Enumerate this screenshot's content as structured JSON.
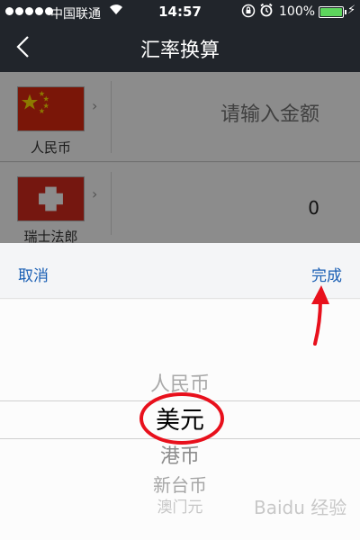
{
  "status_bar": {
    "carrier": "中国联通",
    "time": "14:57",
    "battery_percent": "100%",
    "battery_level": 1.0,
    "signal_bars": 5,
    "icons": [
      "wifi-icon",
      "rotation-lock-icon",
      "alarm-icon",
      "battery-icon",
      "charging-icon"
    ]
  },
  "nav": {
    "title": "汇率换算",
    "back_icon": "chevron-left-icon"
  },
  "currency_rows": [
    {
      "name": "人民币",
      "flag": "china-flag-icon",
      "amount_placeholder": "请输入金额"
    },
    {
      "name": "瑞士法郎",
      "flag": "switzerland-flag-icon",
      "amount": "0"
    }
  ],
  "picker": {
    "cancel_label": "取消",
    "done_label": "完成",
    "options": [
      "人民币",
      "美元",
      "港币",
      "新台币",
      "澳门元"
    ],
    "selected": "美元"
  },
  "colors": {
    "nav_background": "#21252b",
    "picker_action": "#1a5fb4",
    "annotation": "#e8101c",
    "battery": "#5dd55d"
  },
  "watermark": "Baidu 经验"
}
